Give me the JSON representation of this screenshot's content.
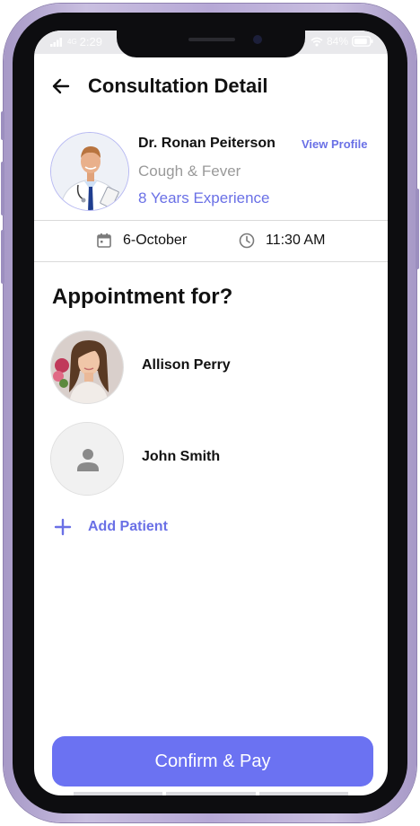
{
  "statusbar": {
    "signal_text": "4G",
    "time": "2:29",
    "battery": "84%"
  },
  "header": {
    "title": "Consultation Detail",
    "back_icon": "arrow-left-icon"
  },
  "doctor": {
    "name": "Dr. Ronan Peiterson",
    "view_profile_label": "View Profile",
    "specialty": "Cough & Fever",
    "experience": "8 Years Experience"
  },
  "appointment": {
    "date": "6-October",
    "time": "11:30 AM",
    "date_icon": "calendar-icon",
    "time_icon": "clock-icon"
  },
  "patients_section": {
    "title": "Appointment for?",
    "patients": [
      {
        "name": "Allison Perry",
        "avatar": "photo"
      },
      {
        "name": "John Smith",
        "avatar": "person-placeholder-icon"
      }
    ],
    "add_label": "Add Patient",
    "add_icon": "plus-icon"
  },
  "footer": {
    "confirm_label": "Confirm & Pay"
  },
  "colors": {
    "accent": "#6a70e6",
    "button": "#6b72f2",
    "phone_frame": "#b6a8d6"
  }
}
